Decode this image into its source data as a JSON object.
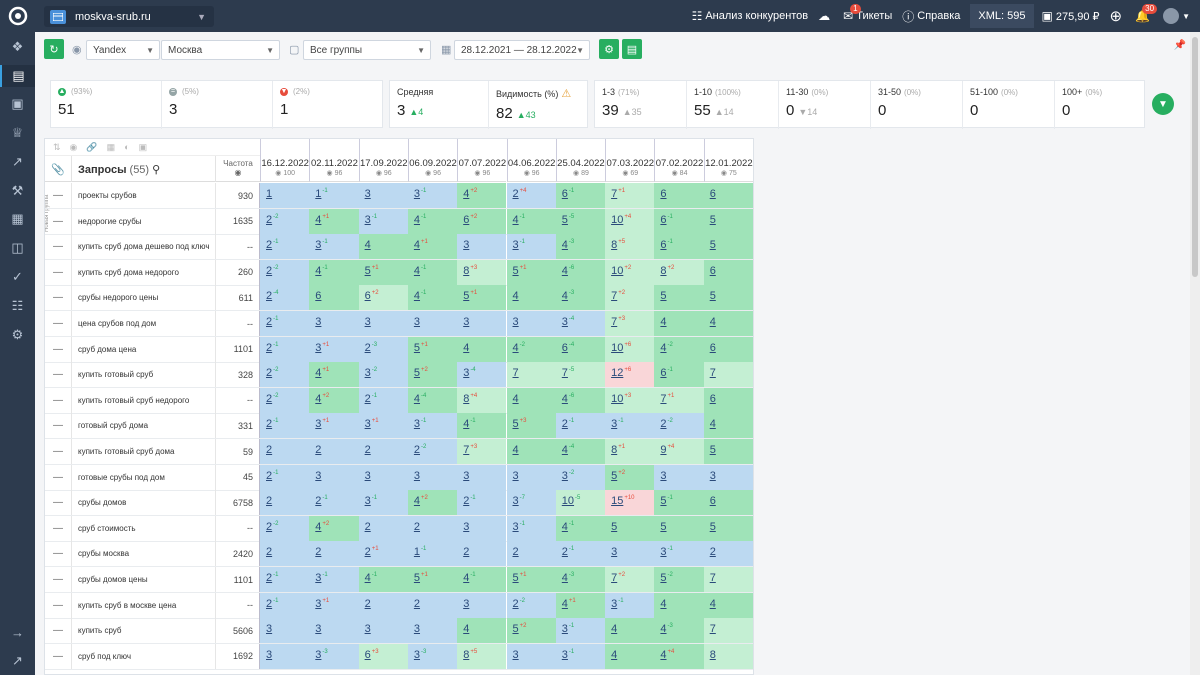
{
  "topbar": {
    "site": "moskva-srub.ru",
    "competitors": "Анализ конкурентов",
    "tickets": "Тикеты",
    "tickets_badge": "1",
    "help": "Справка",
    "xml": "XML: 595",
    "balance": "275,90 ₽",
    "notifications_badge": "30"
  },
  "toolbar": {
    "engine": "Yandex",
    "region": "Москва",
    "group": "Все группы",
    "date_range": "28.12.2021 — 28.12.2022"
  },
  "summary": {
    "up": {
      "label": "(93%)",
      "value": "51"
    },
    "same": {
      "label": "(5%)",
      "value": "3"
    },
    "down": {
      "label": "(2%)",
      "value": "1"
    },
    "avg": {
      "label": "Средняя",
      "value": "3",
      "delta": "4"
    },
    "visibility": {
      "label": "Видимость (%)",
      "value": "82",
      "delta": "43"
    },
    "r1_3": {
      "label": "1-3",
      "pct": "(71%)",
      "value": "39",
      "delta": "35"
    },
    "r1_10": {
      "label": "1-10",
      "pct": "(100%)",
      "value": "55",
      "delta": "14"
    },
    "r11_30": {
      "label": "11-30",
      "pct": "(0%)",
      "value": "0",
      "delta": "14"
    },
    "r31_50": {
      "label": "31-50",
      "pct": "(0%)",
      "value": "0"
    },
    "r51_100": {
      "label": "51-100",
      "pct": "(0%)",
      "value": "0"
    },
    "r100p": {
      "label": "100+",
      "pct": "(0%)",
      "value": "0"
    }
  },
  "table": {
    "queries_title": "Запросы",
    "queries_count": "(55)",
    "freq_header": "Частота",
    "side_label": "Новая группа",
    "dates": [
      {
        "d": "16.12.2022",
        "v": "100"
      },
      {
        "d": "02.11.2022",
        "v": "96"
      },
      {
        "d": "17.09.2022",
        "v": "96"
      },
      {
        "d": "06.09.2022",
        "v": "96"
      },
      {
        "d": "07.07.2022",
        "v": "96"
      },
      {
        "d": "04.06.2022",
        "v": "96"
      },
      {
        "d": "25.04.2022",
        "v": "89"
      },
      {
        "d": "07.03.2022",
        "v": "69"
      },
      {
        "d": "07.02.2022",
        "v": "84"
      },
      {
        "d": "12.01.2022",
        "v": "75"
      }
    ],
    "rows": [
      {
        "q": "проекты срубов",
        "f": "930",
        "p": [
          [
            "1",
            "",
            "b"
          ],
          [
            "1",
            "-1",
            "b"
          ],
          [
            "3",
            "",
            "b"
          ],
          [
            "3",
            "-1",
            "b"
          ],
          [
            "4",
            "+2",
            "g"
          ],
          [
            "2",
            "+4",
            "b"
          ],
          [
            "6",
            "-1",
            "g"
          ],
          [
            "7",
            "+1",
            "l"
          ],
          [
            "6",
            "",
            "g"
          ],
          [
            "6",
            "",
            "g"
          ]
        ]
      },
      {
        "q": "недорогие срубы",
        "f": "1635",
        "p": [
          [
            "2",
            "-2",
            "b"
          ],
          [
            "4",
            "+1",
            "g"
          ],
          [
            "3",
            "-1",
            "b"
          ],
          [
            "4",
            "-1",
            "g"
          ],
          [
            "6",
            "+2",
            "g"
          ],
          [
            "4",
            "-1",
            "g"
          ],
          [
            "5",
            "-5",
            "g"
          ],
          [
            "10",
            "+4",
            "l"
          ],
          [
            "6",
            "-1",
            "g"
          ],
          [
            "5",
            "",
            "g"
          ]
        ]
      },
      {
        "q": "купить сруб дома дешево под ключ",
        "f": "--",
        "p": [
          [
            "2",
            "-1",
            "b"
          ],
          [
            "3",
            "-1",
            "b"
          ],
          [
            "4",
            "",
            "g"
          ],
          [
            "4",
            "+1",
            "g"
          ],
          [
            "3",
            "",
            "b"
          ],
          [
            "3",
            "-1",
            "b"
          ],
          [
            "4",
            "-3",
            "g"
          ],
          [
            "8",
            "+5",
            "l"
          ],
          [
            "6",
            "-1",
            "g"
          ],
          [
            "5",
            "",
            "g"
          ]
        ]
      },
      {
        "q": "купить сруб дома недорого",
        "f": "260",
        "p": [
          [
            "2",
            "-2",
            "b"
          ],
          [
            "4",
            "-1",
            "g"
          ],
          [
            "5",
            "+1",
            "g"
          ],
          [
            "4",
            "-1",
            "g"
          ],
          [
            "8",
            "+3",
            "l"
          ],
          [
            "5",
            "+1",
            "g"
          ],
          [
            "4",
            "-6",
            "g"
          ],
          [
            "10",
            "+2",
            "l"
          ],
          [
            "8",
            "+2",
            "l"
          ],
          [
            "6",
            "",
            "g"
          ]
        ]
      },
      {
        "q": "срубы недорого цены",
        "f": "611",
        "p": [
          [
            "2",
            "-4",
            "b"
          ],
          [
            "6",
            "",
            "g"
          ],
          [
            "6",
            "+2",
            "l"
          ],
          [
            "4",
            "-1",
            "g"
          ],
          [
            "5",
            "+1",
            "g"
          ],
          [
            "4",
            "",
            "g"
          ],
          [
            "4",
            "-3",
            "g"
          ],
          [
            "7",
            "+2",
            "l"
          ],
          [
            "5",
            "",
            "g"
          ],
          [
            "5",
            "",
            "g"
          ]
        ]
      },
      {
        "q": "цена срубов под дом",
        "f": "--",
        "p": [
          [
            "2",
            "-1",
            "b"
          ],
          [
            "3",
            "",
            "b"
          ],
          [
            "3",
            "",
            "b"
          ],
          [
            "3",
            "",
            "b"
          ],
          [
            "3",
            "",
            "b"
          ],
          [
            "3",
            "",
            "b"
          ],
          [
            "3",
            "-4",
            "b"
          ],
          [
            "7",
            "+3",
            "l"
          ],
          [
            "4",
            "",
            "g"
          ],
          [
            "4",
            "",
            "g"
          ]
        ]
      },
      {
        "q": "сруб дома цена",
        "f": "1101",
        "p": [
          [
            "2",
            "-1",
            "b"
          ],
          [
            "3",
            "+1",
            "b"
          ],
          [
            "2",
            "-3",
            "b"
          ],
          [
            "5",
            "+1",
            "g"
          ],
          [
            "4",
            "",
            "g"
          ],
          [
            "4",
            "-2",
            "g"
          ],
          [
            "6",
            "-4",
            "g"
          ],
          [
            "10",
            "+6",
            "l"
          ],
          [
            "4",
            "-2",
            "g"
          ],
          [
            "6",
            "",
            "g"
          ]
        ]
      },
      {
        "q": "купить готовый сруб",
        "f": "328",
        "p": [
          [
            "2",
            "-2",
            "b"
          ],
          [
            "4",
            "+1",
            "g"
          ],
          [
            "3",
            "-2",
            "b"
          ],
          [
            "5",
            "+2",
            "g"
          ],
          [
            "3",
            "-4",
            "b"
          ],
          [
            "7",
            "",
            "l"
          ],
          [
            "7",
            "-5",
            "l"
          ],
          [
            "12",
            "+6",
            "r"
          ],
          [
            "6",
            "-1",
            "g"
          ],
          [
            "7",
            "",
            "l"
          ]
        ]
      },
      {
        "q": "купить готовый сруб недорого",
        "f": "--",
        "p": [
          [
            "2",
            "-2",
            "b"
          ],
          [
            "4",
            "+2",
            "g"
          ],
          [
            "2",
            "-1",
            "b"
          ],
          [
            "4",
            "-4",
            "g"
          ],
          [
            "8",
            "+4",
            "l"
          ],
          [
            "4",
            "",
            "g"
          ],
          [
            "4",
            "-6",
            "g"
          ],
          [
            "10",
            "+3",
            "l"
          ],
          [
            "7",
            "+1",
            "l"
          ],
          [
            "6",
            "",
            "g"
          ]
        ]
      },
      {
        "q": "готовый сруб дома",
        "f": "331",
        "p": [
          [
            "2",
            "-1",
            "b"
          ],
          [
            "3",
            "+1",
            "b"
          ],
          [
            "3",
            "+1",
            "b"
          ],
          [
            "3",
            "-1",
            "b"
          ],
          [
            "4",
            "-1",
            "g"
          ],
          [
            "5",
            "+3",
            "g"
          ],
          [
            "2",
            "-1",
            "b"
          ],
          [
            "3",
            "-1",
            "b"
          ],
          [
            "2",
            "-2",
            "b"
          ],
          [
            "4",
            "",
            "g"
          ]
        ]
      },
      {
        "q": "купить готовый сруб дома",
        "f": "59",
        "p": [
          [
            "2",
            "",
            "b"
          ],
          [
            "2",
            "",
            "b"
          ],
          [
            "2",
            "",
            "b"
          ],
          [
            "2",
            "-2",
            "b"
          ],
          [
            "7",
            "+3",
            "l"
          ],
          [
            "4",
            "",
            "g"
          ],
          [
            "4",
            "-4",
            "g"
          ],
          [
            "8",
            "+1",
            "l"
          ],
          [
            "9",
            "+4",
            "l"
          ],
          [
            "5",
            "",
            "g"
          ]
        ]
      },
      {
        "q": "готовые срубы под дом",
        "f": "45",
        "p": [
          [
            "2",
            "-1",
            "b"
          ],
          [
            "3",
            "",
            "b"
          ],
          [
            "3",
            "",
            "b"
          ],
          [
            "3",
            "",
            "b"
          ],
          [
            "3",
            "",
            "b"
          ],
          [
            "3",
            "",
            "b"
          ],
          [
            "3",
            "-2",
            "b"
          ],
          [
            "5",
            "+2",
            "g"
          ],
          [
            "3",
            "",
            "b"
          ],
          [
            "3",
            "",
            "b"
          ]
        ]
      },
      {
        "q": "срубы домов",
        "f": "6758",
        "p": [
          [
            "2",
            "",
            "b"
          ],
          [
            "2",
            "-1",
            "b"
          ],
          [
            "3",
            "-1",
            "b"
          ],
          [
            "4",
            "+2",
            "g"
          ],
          [
            "2",
            "-1",
            "b"
          ],
          [
            "3",
            "-7",
            "b"
          ],
          [
            "10",
            "-5",
            "l"
          ],
          [
            "15",
            "+10",
            "r"
          ],
          [
            "5",
            "-1",
            "g"
          ],
          [
            "6",
            "",
            "g"
          ]
        ]
      },
      {
        "q": "сруб стоимость",
        "f": "--",
        "p": [
          [
            "2",
            "-2",
            "b"
          ],
          [
            "4",
            "+2",
            "g"
          ],
          [
            "2",
            "",
            "b"
          ],
          [
            "2",
            "",
            "b"
          ],
          [
            "3",
            "",
            "b"
          ],
          [
            "3",
            "-1",
            "b"
          ],
          [
            "4",
            "-1",
            "g"
          ],
          [
            "5",
            "",
            "g"
          ],
          [
            "5",
            "",
            "g"
          ],
          [
            "5",
            "",
            "g"
          ]
        ]
      },
      {
        "q": "срубы москва",
        "f": "2420",
        "p": [
          [
            "2",
            "",
            "b"
          ],
          [
            "2",
            "",
            "b"
          ],
          [
            "2",
            "+1",
            "b"
          ],
          [
            "1",
            "-1",
            "b"
          ],
          [
            "2",
            "",
            "b"
          ],
          [
            "2",
            "",
            "b"
          ],
          [
            "2",
            "-1",
            "b"
          ],
          [
            "3",
            "",
            "b"
          ],
          [
            "3",
            "-1",
            "b"
          ],
          [
            "2",
            "",
            "b"
          ]
        ]
      },
      {
        "q": "срубы домов цены",
        "f": "1101",
        "p": [
          [
            "2",
            "-1",
            "b"
          ],
          [
            "3",
            "-1",
            "b"
          ],
          [
            "4",
            "-1",
            "g"
          ],
          [
            "5",
            "+1",
            "g"
          ],
          [
            "4",
            "-1",
            "g"
          ],
          [
            "5",
            "+1",
            "g"
          ],
          [
            "4",
            "-3",
            "g"
          ],
          [
            "7",
            "+2",
            "l"
          ],
          [
            "5",
            "-2",
            "g"
          ],
          [
            "7",
            "",
            "l"
          ]
        ]
      },
      {
        "q": "купить сруб в москве цена",
        "f": "--",
        "p": [
          [
            "2",
            "-1",
            "b"
          ],
          [
            "3",
            "+1",
            "b"
          ],
          [
            "2",
            "",
            "b"
          ],
          [
            "2",
            "",
            "b"
          ],
          [
            "3",
            "",
            "b"
          ],
          [
            "2",
            "-2",
            "b"
          ],
          [
            "4",
            "+1",
            "g"
          ],
          [
            "3",
            "-1",
            "b"
          ],
          [
            "4",
            "",
            "g"
          ],
          [
            "4",
            "",
            "g"
          ]
        ]
      },
      {
        "q": "купить сруб",
        "f": "5606",
        "p": [
          [
            "3",
            "",
            "b"
          ],
          [
            "3",
            "",
            "b"
          ],
          [
            "3",
            "",
            "b"
          ],
          [
            "3",
            "",
            "b"
          ],
          [
            "4",
            "",
            "g"
          ],
          [
            "5",
            "+2",
            "g"
          ],
          [
            "3",
            "-1",
            "b"
          ],
          [
            "4",
            "",
            "g"
          ],
          [
            "4",
            "-3",
            "g"
          ],
          [
            "7",
            "",
            "l"
          ]
        ]
      },
      {
        "q": "сруб под ключ",
        "f": "1692",
        "p": [
          [
            "3",
            "",
            "b"
          ],
          [
            "3",
            "-3",
            "b"
          ],
          [
            "6",
            "+3",
            "l"
          ],
          [
            "3",
            "-3",
            "b"
          ],
          [
            "8",
            "+5",
            "l"
          ],
          [
            "3",
            "",
            "b"
          ],
          [
            "3",
            "-1",
            "b"
          ],
          [
            "4",
            "",
            "g"
          ],
          [
            "4",
            "+4",
            "g"
          ],
          [
            "8",
            "",
            "l"
          ]
        ]
      }
    ]
  }
}
